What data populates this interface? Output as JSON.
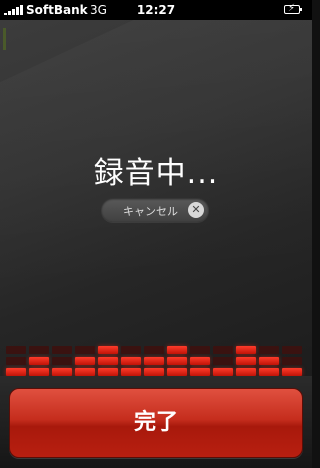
{
  "status_bar": {
    "carrier": "SoftBank",
    "network": "3G",
    "time": "12:27",
    "signal_bars": 5,
    "battery_icon": "battery-charging-icon"
  },
  "recorder": {
    "title": "録音中...",
    "cancel_label": "キャンセル",
    "cancel_icon": "close-circle-icon",
    "meter_levels": [
      1,
      2,
      1,
      2,
      3,
      2,
      2,
      3,
      2,
      1,
      3,
      2,
      1
    ],
    "accent_color": "#e0301e"
  },
  "footer": {
    "done_label": "完了"
  }
}
